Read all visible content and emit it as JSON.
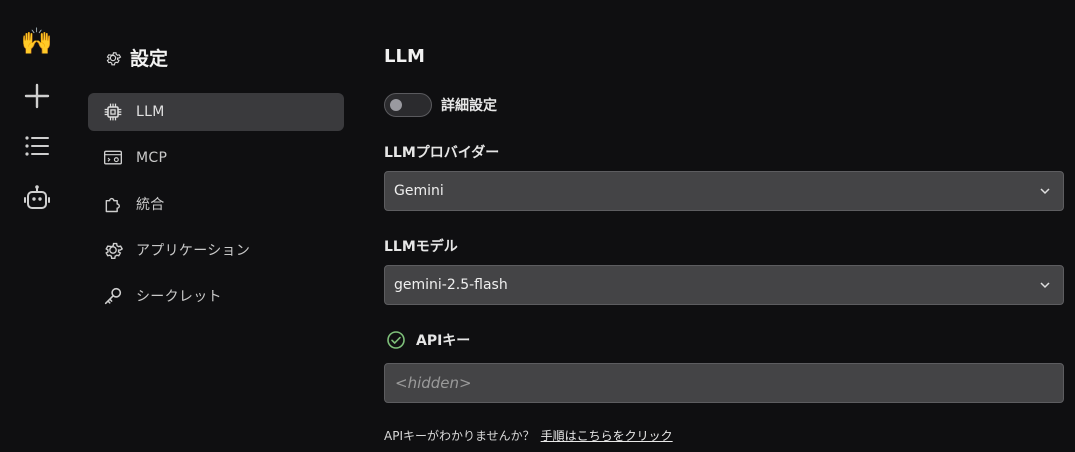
{
  "rail": {
    "logo_emoji": "🙌",
    "icons": [
      "new-chat-icon",
      "list-icon",
      "robot-icon"
    ]
  },
  "settings": {
    "title": "設定",
    "nav": [
      {
        "label": "LLM",
        "icon": "chip-icon",
        "active": true
      },
      {
        "label": "MCP",
        "icon": "server-gear-icon",
        "active": false
      },
      {
        "label": "統合",
        "icon": "puzzle-icon",
        "active": false
      },
      {
        "label": "アプリケーション",
        "icon": "gear-icon",
        "active": false
      },
      {
        "label": "シークレット",
        "icon": "key-icon",
        "active": false
      }
    ]
  },
  "main": {
    "heading": "LLM",
    "advanced_toggle": {
      "label": "詳細設定",
      "on": false
    },
    "provider": {
      "label": "LLMプロバイダー",
      "value": "Gemini"
    },
    "model": {
      "label": "LLMモデル",
      "value": "gemini-2.5-flash"
    },
    "api_key": {
      "label": "APIキー",
      "placeholder": "<hidden>",
      "status": "valid"
    },
    "help_text": "APIキーがわかりませんか？",
    "help_link": "手順はこちらをクリック"
  },
  "colors": {
    "accent_check": "#7ec07a",
    "background": "#0f0f11",
    "active_nav": "#3a3a3d"
  }
}
